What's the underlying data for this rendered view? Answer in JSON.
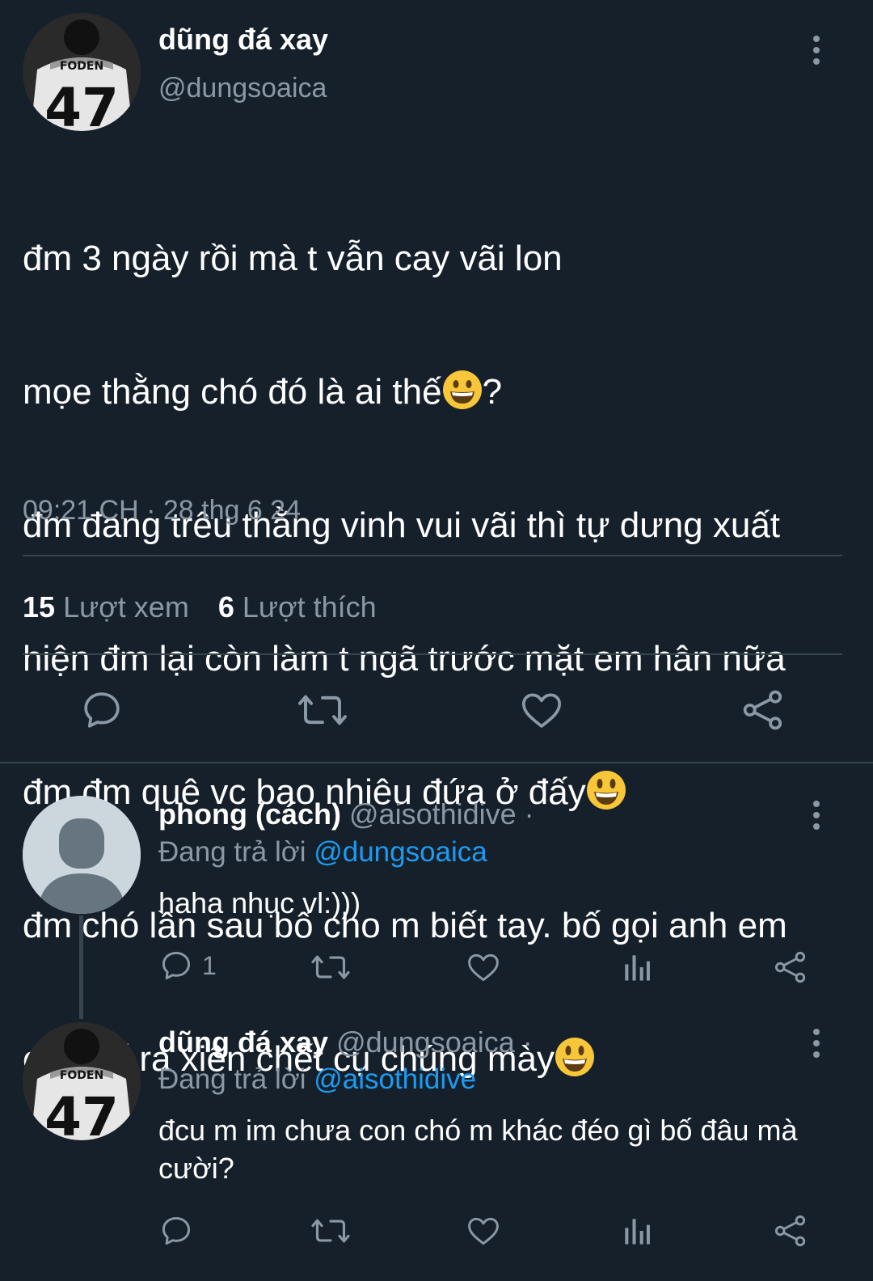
{
  "main_tweet": {
    "display_name": "dũng đá xay",
    "handle": "@dungsoaica",
    "avatar_jersey_name": "FODEN",
    "avatar_jersey_number": "47",
    "text_lines": [
      "đm 3 ngày rồi mà t vẫn cay vãi lon",
      "mọe thằng chó đó là ai thế",
      "?",
      "đm đang trêu thằng vinh vui vãi thì tự dưng xuất",
      "hiện đm lại còn làm t ngã trước mặt em hân nữa",
      "đm đm quê vc bao nhiêu đứa ở đấy",
      "đm chó lần sau bố cho m biết tay. bố gọi anh em",
      "của bố ra xiên chết cụ chúng mày"
    ],
    "timestamp": "09:21 CH · 28 thg 6 24",
    "views_count": "15",
    "views_label": "Lượt xem",
    "likes_count": "6",
    "likes_label": "Lượt thích"
  },
  "replies": [
    {
      "display_name": "phong (cách)",
      "handle": "@aisothidive ·",
      "replying_prefix": "Đang trả lời",
      "replying_to": "@dungsoaica",
      "text": "haha nhục vl:)))",
      "reply_count": "1"
    },
    {
      "display_name": "dũng đá xay",
      "handle": "@dungsoaica ·",
      "replying_prefix": "Đang trả lời",
      "replying_to": "@aisothidive",
      "text": "đcu m im chưa con chó m khác đéo gì bố đâu mà cười?",
      "avatar_jersey_name": "FODEN",
      "avatar_jersey_number": "47"
    }
  ],
  "colors": {
    "background": "#15202b",
    "text_primary": "#ffffff",
    "text_secondary": "#8b98a5",
    "link": "#1d9bf0",
    "divider": "#38444d"
  },
  "icons": {
    "comment": "comment-icon",
    "retweet": "retweet-icon",
    "like": "heart-icon",
    "share": "share-icon",
    "views": "bar-chart-icon",
    "more": "kebab-menu-icon",
    "emoji_grin": "grinning-face-emoji",
    "emoji_smile": "smiling-face-emoji"
  }
}
